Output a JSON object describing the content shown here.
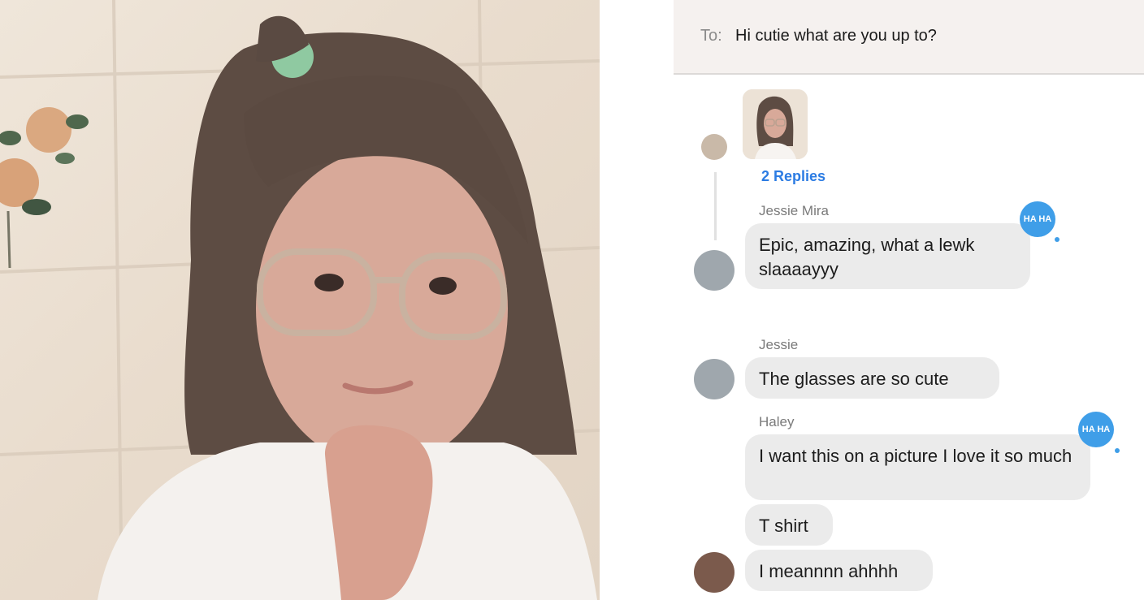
{
  "photo": {
    "alt_icon": "child-with-glasses-photo"
  },
  "header": {
    "to_label": "To:",
    "to_value": "Hi cutie what are you up to?"
  },
  "thread": {
    "replies_label": "2 Replies"
  },
  "messages": [
    {
      "sender": "Jessie Mira",
      "text": "Epic, amazing, what a lewk slaaaayyy",
      "reaction": "HA HA"
    },
    {
      "sender": "Jessie",
      "text": "The glasses are so cute"
    },
    {
      "sender": "Haley",
      "text": "I want this on a picture I love it so much",
      "reaction": "HA HA"
    },
    {
      "sender": "",
      "text": "T shirt"
    },
    {
      "sender": "",
      "text": "I meannnn ahhhh"
    }
  ],
  "colors": {
    "accent": "#2c7ce3",
    "bubble": "#ebebeb",
    "reaction": "#3f9ee8"
  }
}
